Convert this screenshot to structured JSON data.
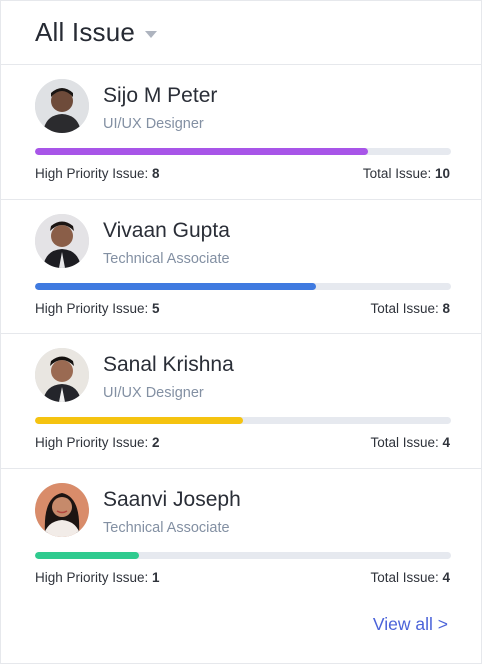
{
  "header": {
    "title": "All Issue",
    "dropdown_icon": "caret-down-icon"
  },
  "labels": {
    "high_priority": "High Priority Issue: ",
    "total": "Total Issue: "
  },
  "people": [
    {
      "name": "Sijo M Peter",
      "role": "UI/UX Designer",
      "high_priority": "8",
      "total": "10",
      "progress": 0.8,
      "color": "#a855e8"
    },
    {
      "name": "Vivaan Gupta",
      "role": "Technical Associate",
      "high_priority": "5",
      "total": "8",
      "progress": 0.675,
      "color": "#3f7ae0"
    },
    {
      "name": "Sanal Krishna",
      "role": "UI/UX Designer",
      "high_priority": "2",
      "total": "4",
      "progress": 0.5,
      "color": "#f5c310"
    },
    {
      "name": "Saanvi Joseph",
      "role": "Technical Associate",
      "high_priority": "1",
      "total": "4",
      "progress": 0.25,
      "color": "#2fcb8f"
    }
  ],
  "footer": {
    "view_all": "View all >"
  }
}
